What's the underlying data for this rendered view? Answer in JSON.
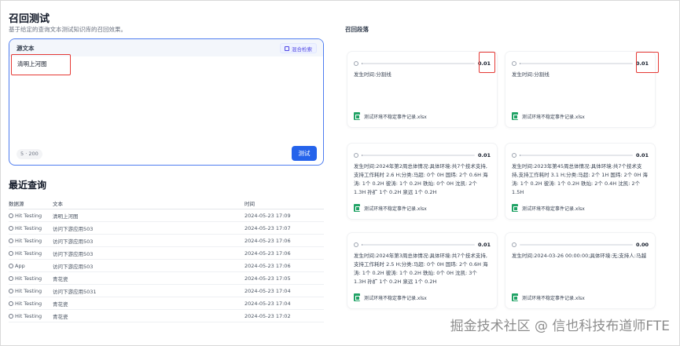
{
  "page": {
    "title": "召回测试",
    "subtitle": "基于给定的查询文本测试知识库的召回效果。"
  },
  "source": {
    "label": "源文本",
    "mixed_search": "混合检索",
    "query": "清明上河图",
    "counter": "5 · 200",
    "test_button": "测试"
  },
  "recent": {
    "title": "最近查询",
    "columns": [
      "数据源",
      "文本",
      "时间"
    ],
    "rows": [
      {
        "source": "Hit Testing",
        "text": "清明上河图",
        "time": "2024-05-23 17:09"
      },
      {
        "source": "Hit Testing",
        "text": "访问下游应用503",
        "time": "2024-05-23 17:07"
      },
      {
        "source": "Hit Testing",
        "text": "访问下游应用503",
        "time": "2024-05-23 17:06"
      },
      {
        "source": "Hit Testing",
        "text": "访问下游应用503",
        "time": "2024-05-23 17:06"
      },
      {
        "source": "App",
        "text": "访问下游应用503",
        "time": "2024-05-23 17:06"
      },
      {
        "source": "Hit Testing",
        "text": "青花瓷",
        "time": "2024-05-23 17:05"
      },
      {
        "source": "Hit Testing",
        "text": "访问下游应用5031",
        "time": "2024-05-23 17:04"
      },
      {
        "source": "Hit Testing",
        "text": "青花瓷",
        "time": "2024-05-23 17:04"
      },
      {
        "source": "Hit Testing",
        "text": "青花瓷",
        "time": "2024-05-23 17:02"
      }
    ]
  },
  "results": {
    "title": "召回段落",
    "cards": [
      {
        "score": "0.01",
        "score_fraction": 0.01,
        "content": "发生时间:分割线",
        "file": "测试环境不稳定事件记录.xlsx"
      },
      {
        "score": "0.01",
        "score_fraction": 0.01,
        "content": "发生时间:分割线",
        "file": "测试环境不稳定事件记录.xlsx"
      },
      {
        "score": "0.01",
        "score_fraction": 0.01,
        "content": "发生时间:2024年第2周总体情况:具体环境:共7个技术支持,支持工作耗时 2.6 H;分类:马超: 0个 0H 国玮: 2个 0.6H 海涛: 1个 0.2H 彼涛: 1个 0.2H 轶灿: 0个 0H 沈凯: 2个 1.3H 孙扩 1个 0.2H 泉远 1个 0.2H",
        "file": "测试环境不稳定事件记录.xlsx"
      },
      {
        "score": "0.01",
        "score_fraction": 0.01,
        "content": "发生时间:2023年第45周总体情况:具体环境:共7个技术支持,支持工作耗时 3.1 H;分类:马超: 2个 1H 国玮: 2个 0H 海涛: 1个 0.2H 彼涛: 1个 0.2H 轶灿: 2个 0.4H 沈凯: 2个 1.5H",
        "file": "测试环境不稳定事件记录.xlsx"
      },
      {
        "score": "0.01",
        "score_fraction": 0.01,
        "content": "发生时间:2024年第3周总体情况:具体环境:共7个技术支持,支持工作耗时 2.5 H;分类:马超: 0个 0H 国玮: 2个 0.6H 海涛: 1个 0.2H 彼涛: 1个 0.2H 轶灿: 0个 0H 沈凯: 3个 1.3H 孙扩 1个 0.2H 泉远 1个 0.2H",
        "file": "测试环境不稳定事件记录.xlsx"
      },
      {
        "score": "0.00",
        "score_fraction": 0.0,
        "content": "发生时间:2024-03-26 00:00:00;具体环境:无;支持人:马越",
        "file": "测试环境不稳定事件记录.xlsx"
      }
    ]
  },
  "watermark": "掘金技术社区 @ 信也科技布道师FTE"
}
